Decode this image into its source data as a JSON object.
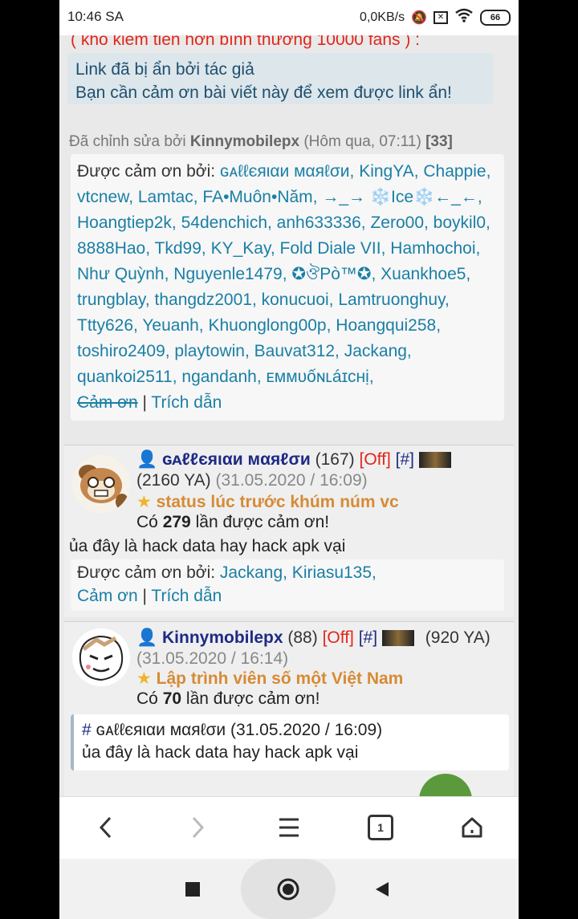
{
  "status_bar": {
    "time": "10:46 SA",
    "network_speed": "0,0KB/s",
    "battery": "66"
  },
  "post1": {
    "top_text": "( khó kiếm tiền hơn bình thường 10000 fans ) :",
    "hidden_line1": "Link đã bị ẩn bởi tác giả",
    "hidden_line2": "Bạn cần cảm ơn bài viết này để xem được link ẩn!",
    "edited_prefix": "Đã chỉnh sửa bởi",
    "edited_user": "Kinnymobilepx",
    "edited_time": "(Hôm qua, 07:11)",
    "edited_count": "[33]",
    "thanks_label": "Được cảm ơn bởi:",
    "thanks_users": "ɢᴀℓℓєяιαи мαяℓσи, KingYA, Chappie, vtcnew, Lamtac, FA•Muôn•Năm, →_→ ❄️Ice❄️←_←, Hoangtiep2k, 54denchich, anh633336, Zero00, boykil0, 8888Hao, Tkd99, KY_Kay, Fold Diale VII, Hamhochoi, Như Quỳnh, Nguyenle1479, ✪ঔPò™✪, Xuankhoe5, trungblay, thangdz2001, konucuoi, Lamtruonghuy, Ttty626, Yeuanh, Khuonglong00p, Hoangqui258, toshiro2409, playtowin, Bauvat312, Jackang, quankoi2511, ngandanh, ᴇᴍᴍᴜốɴʟáɪᴄʜị,",
    "thank_link": "Cảm ơn",
    "separator": "|",
    "quote_link": "Trích dẫn"
  },
  "post2": {
    "username": "ɢᴀℓℓєяιαи мαяℓσи",
    "post_count": "(167)",
    "status": "[Off]",
    "hash": "[#]",
    "ya": "(2160 YA)",
    "date": "(31.05.2020 / 16:09)",
    "title": "status lúc trước khúm núm vc",
    "thanks_prefix": "Có",
    "thanks_count": "279",
    "thanks_suffix": "lần được cảm ơn!",
    "body": "ủa đây là hack data hay hack apk vại",
    "thanks_label": "Được cảm ơn bởi:",
    "thanks_users": "Jackang, Kiriasu135,",
    "thank_link": "Cảm ơn",
    "separator": "|",
    "quote_link": "Trích dẫn"
  },
  "post3": {
    "username": "Kinnymobilepx",
    "post_count": "(88)",
    "status": "[Off]",
    "hash": "[#]",
    "ya": "(920 YA)",
    "date": "(31.05.2020 / 16:14)",
    "title": "Lập trình viên số một Việt Nam",
    "thanks_prefix": "Có",
    "thanks_count": "70",
    "thanks_suffix": "lần được cảm ơn!",
    "quote_header_hash": "#",
    "quote_header_user": "ɢᴀℓℓєяιαи мαяℓσи",
    "quote_header_date": "(31.05.2020 / 16:09)",
    "quote_body": "ủa đây là hack data hay hack apk vại"
  },
  "browser_nav": {
    "tab_count": "1"
  },
  "colors": {
    "link": "#1a7fa5",
    "username": "#1e2a85",
    "off_status": "#e0261b",
    "title": "#d68b35"
  }
}
